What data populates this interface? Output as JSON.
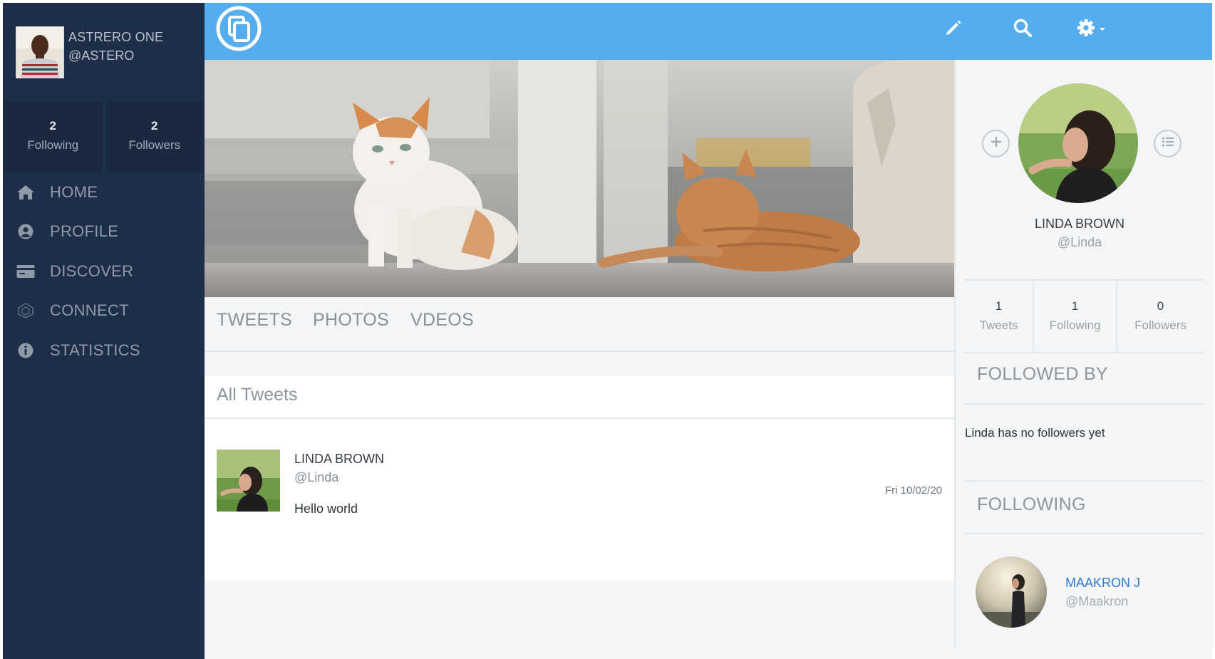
{
  "current_user": {
    "name": "ASTRERO ONE",
    "handle": "@ASTERO",
    "following_count": "2",
    "following_label": "Following",
    "followers_count": "2",
    "followers_label": "Followers"
  },
  "nav": {
    "items": [
      {
        "label": "HOME",
        "icon": "home-icon"
      },
      {
        "label": "PROFILE",
        "icon": "user-circle-icon"
      },
      {
        "label": "DISCOVER",
        "icon": "card-icon"
      },
      {
        "label": "CONNECT",
        "icon": "network-icon"
      },
      {
        "label": "STATISTICS",
        "icon": "info-icon"
      }
    ]
  },
  "topbar": {
    "accent": "#55aded",
    "icons": [
      "logo-icon",
      "pencil-icon",
      "search-icon",
      "gear-dropdown-icon"
    ]
  },
  "tabs": [
    "TWEETS",
    "PHOTOS",
    "VDEOS"
  ],
  "tweets": {
    "title": "All Tweets",
    "items": [
      {
        "name": "LINDA BROWN",
        "handle": "@Linda",
        "text": "Hello world",
        "date": "Fri 10/02/20"
      }
    ]
  },
  "profile": {
    "name": "LINDA BROWN",
    "handle": "@Linda",
    "stats": [
      {
        "value": "1",
        "label": "Tweets"
      },
      {
        "value": "1",
        "label": "Following"
      },
      {
        "value": "0",
        "label": "Followers"
      }
    ]
  },
  "followed_by": {
    "title": "FOLLOWED BY",
    "empty_text": "Linda has no followers yet"
  },
  "following": {
    "title": "FOLLOWING",
    "items": [
      {
        "name": "MAAKRON J",
        "handle": "@Maakron"
      }
    ]
  }
}
